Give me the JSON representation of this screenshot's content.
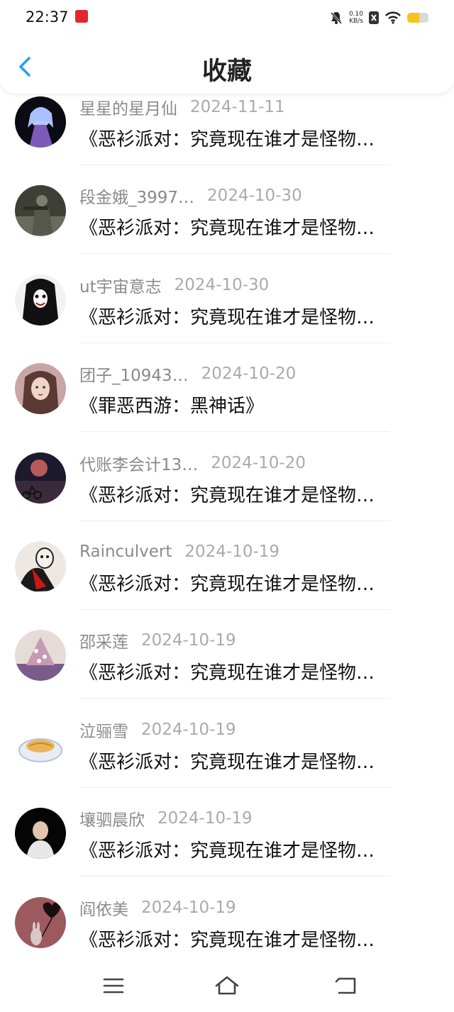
{
  "status_bar": {
    "time": "22:37",
    "speed_value": "0.10",
    "speed_unit": "KB/s",
    "battery_level": 0.55
  },
  "header": {
    "title": "收藏",
    "back_icon": "chevron-left-icon",
    "accent_color": "#2a9df4"
  },
  "items": [
    {
      "username": "星星的星月仙",
      "date": "2024-11-11",
      "title": "《恶衫派对：究竟现在谁才是怪物…"
    },
    {
      "username": "段金娥_3997…",
      "date": "2024-10-30",
      "title": "《恶衫派对：究竟现在谁才是怪物…"
    },
    {
      "username": "ut宇宙意志",
      "date": "2024-10-30",
      "title": "《恶衫派对：究竟现在谁才是怪物…"
    },
    {
      "username": "团子_10943…",
      "date": "2024-10-20",
      "title": "《罪恶西游：黑神话》"
    },
    {
      "username": "代账李会计13…",
      "date": "2024-10-20",
      "title": "《恶衫派对：究竟现在谁才是怪物…"
    },
    {
      "username": "Rainculvert",
      "date": "2024-10-19",
      "title": "《恶衫派对：究竟现在谁才是怪物…"
    },
    {
      "username": "邵采莲",
      "date": "2024-10-19",
      "title": "《恶衫派对：究竟现在谁才是怪物…"
    },
    {
      "username": "泣骊雪",
      "date": "2024-10-19",
      "title": "《恶衫派对：究竟现在谁才是怪物…"
    },
    {
      "username": "壤驷晨欣",
      "date": "2024-10-19",
      "title": "《恶衫派对：究竟现在谁才是怪物…"
    },
    {
      "username": "阎依美",
      "date": "2024-10-19",
      "title": "《恶衫派对：究竟现在谁才是怪物…"
    }
  ],
  "nav_bar": {
    "menu_icon": "menu-icon",
    "home_icon": "home-icon",
    "back_icon": "back-icon"
  }
}
